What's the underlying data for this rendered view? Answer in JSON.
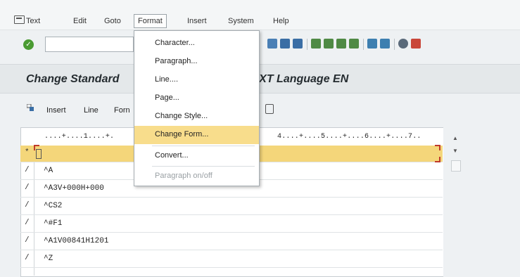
{
  "menubar": {
    "items": [
      "Text",
      "Edit",
      "Goto",
      "Format",
      "Insert",
      "System",
      "Help"
    ],
    "active": "Format"
  },
  "toolbar": {
    "command_value": ""
  },
  "title": {
    "left": "Change Standard",
    "right": "TXT Language EN"
  },
  "appbar": {
    "items": [
      "Insert",
      "Line",
      "Forn"
    ]
  },
  "editor": {
    "ruler": "....+....1....+.",
    "ruler_right": "4....+....5....+....6....+....7..",
    "rows": [
      {
        "mark": "*",
        "text": ""
      },
      {
        "mark": "/",
        "text": "^A"
      },
      {
        "mark": "/",
        "text": "^A3V+000H+000"
      },
      {
        "mark": "/",
        "text": "^CS2"
      },
      {
        "mark": "/",
        "text": "^#F1"
      },
      {
        "mark": "/",
        "text": "^A1V00841H1201"
      },
      {
        "mark": "/",
        "text": "^Z"
      }
    ]
  },
  "format_menu": {
    "items": [
      {
        "label": "Character...",
        "state": "normal"
      },
      {
        "label": "Paragraph...",
        "state": "normal"
      },
      {
        "label": "Line....",
        "state": "normal"
      },
      {
        "label": "Page...",
        "state": "normal"
      },
      {
        "label": "Change Style...",
        "state": "normal"
      },
      {
        "label": "Change Form...",
        "state": "highlighted"
      },
      {
        "label": "Convert...",
        "state": "normal"
      },
      {
        "label": "Paragraph on/off",
        "state": "disabled"
      }
    ]
  },
  "colors": {
    "menu_highlight": "#f8dd8c",
    "selected_row": "#f4d67a",
    "ok_icon": "#4a9b32",
    "mark_red": "#c0392b"
  }
}
